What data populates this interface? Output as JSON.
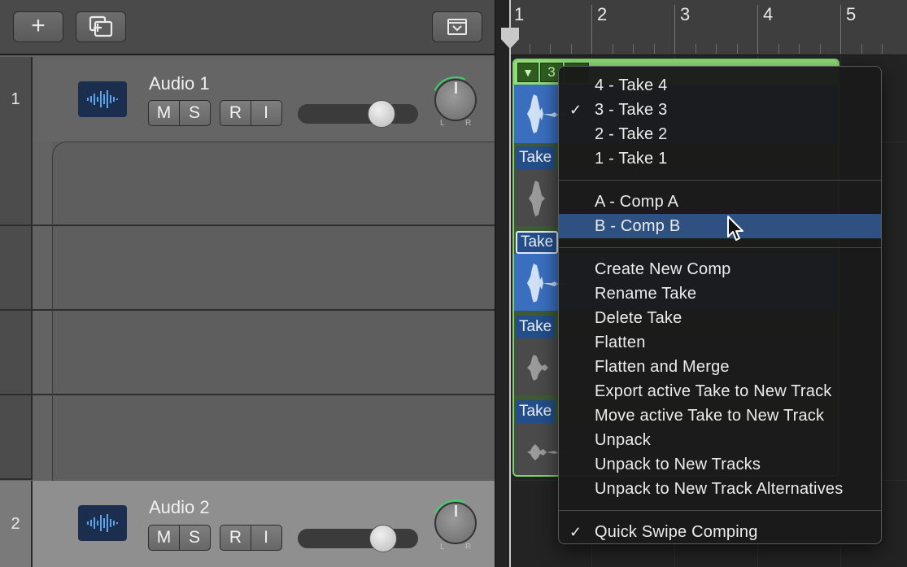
{
  "toolbar": {
    "add_track_label": "+"
  },
  "tracks": [
    {
      "number": "1",
      "name": "Audio 1",
      "mute": "M",
      "solo": "S",
      "record": "R",
      "input": "I",
      "pan_left": "L",
      "pan_right": "R"
    },
    {
      "number": "2",
      "name": "Audio 2",
      "mute": "M",
      "solo": "S",
      "record": "R",
      "input": "I",
      "pan_left": "L",
      "pan_right": "R"
    }
  ],
  "ruler": {
    "bars": [
      "1",
      "2",
      "3",
      "4",
      "5"
    ]
  },
  "take_folder": {
    "toggle": "▼",
    "active_take": "3",
    "take_labels": [
      "Take",
      "Take",
      "Take",
      "Take"
    ]
  },
  "context_menu": {
    "takes": [
      {
        "label": "4 - Take 4",
        "checked": false
      },
      {
        "label": "3 - Take 3",
        "checked": true
      },
      {
        "label": "2 - Take 2",
        "checked": false
      },
      {
        "label": "1 - Take 1",
        "checked": false
      }
    ],
    "comps": [
      {
        "label": "A - Comp A",
        "highlighted": false
      },
      {
        "label": "B - Comp B",
        "highlighted": true
      }
    ],
    "actions": [
      "Create New Comp",
      "Rename Take",
      "Delete Take",
      "Flatten",
      "Flatten and Merge",
      "Export active Take to New Track",
      "Move active Take to New Track",
      "Unpack",
      "Unpack to New Tracks",
      "Unpack to New Track Alternatives"
    ],
    "options": [
      {
        "label": "Quick Swipe Comping",
        "checked": true
      }
    ],
    "check_glyph": "✓"
  },
  "colors": {
    "take_folder_green": "#8fdc78",
    "take_blue": "#3a6fbf",
    "menu_highlight": "#2e5182",
    "pan_indicator": "#3fd06a"
  }
}
